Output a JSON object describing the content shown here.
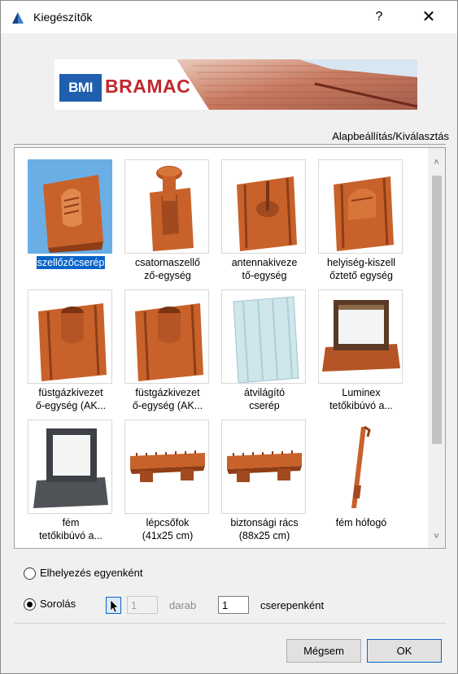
{
  "window": {
    "title": "Kiegészítők",
    "help": "?",
    "close": "✕"
  },
  "banner": {
    "brand_badge": "BMI",
    "brand_name": "BRAMAC"
  },
  "mode_link": "Alapbeállítás/Kiválasztás",
  "gallery": {
    "items": [
      {
        "label": "szellőzőcserép",
        "selected": true,
        "icon": "ventilation-tile"
      },
      {
        "label": "csatornaszellő\nző-egység",
        "selected": false,
        "icon": "sewer-vent-tile"
      },
      {
        "label": "antennakiveze\ntő-egység",
        "selected": false,
        "icon": "antenna-tile"
      },
      {
        "label": "helyiség-kiszell\nőztető egység",
        "selected": false,
        "icon": "room-vent-tile"
      },
      {
        "label": "füstgázkivezet\nő-egység (AK...",
        "selected": false,
        "icon": "flue-tile-1"
      },
      {
        "label": "füstgázkivezet\nő-egység (AK...",
        "selected": false,
        "icon": "flue-tile-2"
      },
      {
        "label": "átvilágító\ncserép",
        "selected": false,
        "icon": "translucent-tile"
      },
      {
        "label": "Luminex\ntetőkibúvó a...",
        "selected": false,
        "icon": "luminex-hatch"
      },
      {
        "label": "fém\ntetőkibúvó a...",
        "selected": false,
        "icon": "metal-hatch"
      },
      {
        "label": "lépcsőfok\n(41x25 cm)",
        "selected": false,
        "icon": "step"
      },
      {
        "label": "biztonsági rács\n(88x25 cm)",
        "selected": false,
        "icon": "safety-grid"
      },
      {
        "label": "fém hófogó",
        "selected": false,
        "icon": "snow-guard"
      }
    ]
  },
  "placement": {
    "option_single": "Elhelyezés egyenként",
    "option_row": "Sorolás",
    "selected": "row",
    "count_value": "1",
    "count_unit": "darab",
    "per_tile_value": "1",
    "per_tile_unit": "cserepenként"
  },
  "buttons": {
    "cancel": "Mégsem",
    "ok": "OK"
  },
  "colors": {
    "tile": "#c8622a",
    "selection": "#0a64c8",
    "brand_blue": "#1f5fae",
    "brand_red": "#c0282d"
  }
}
